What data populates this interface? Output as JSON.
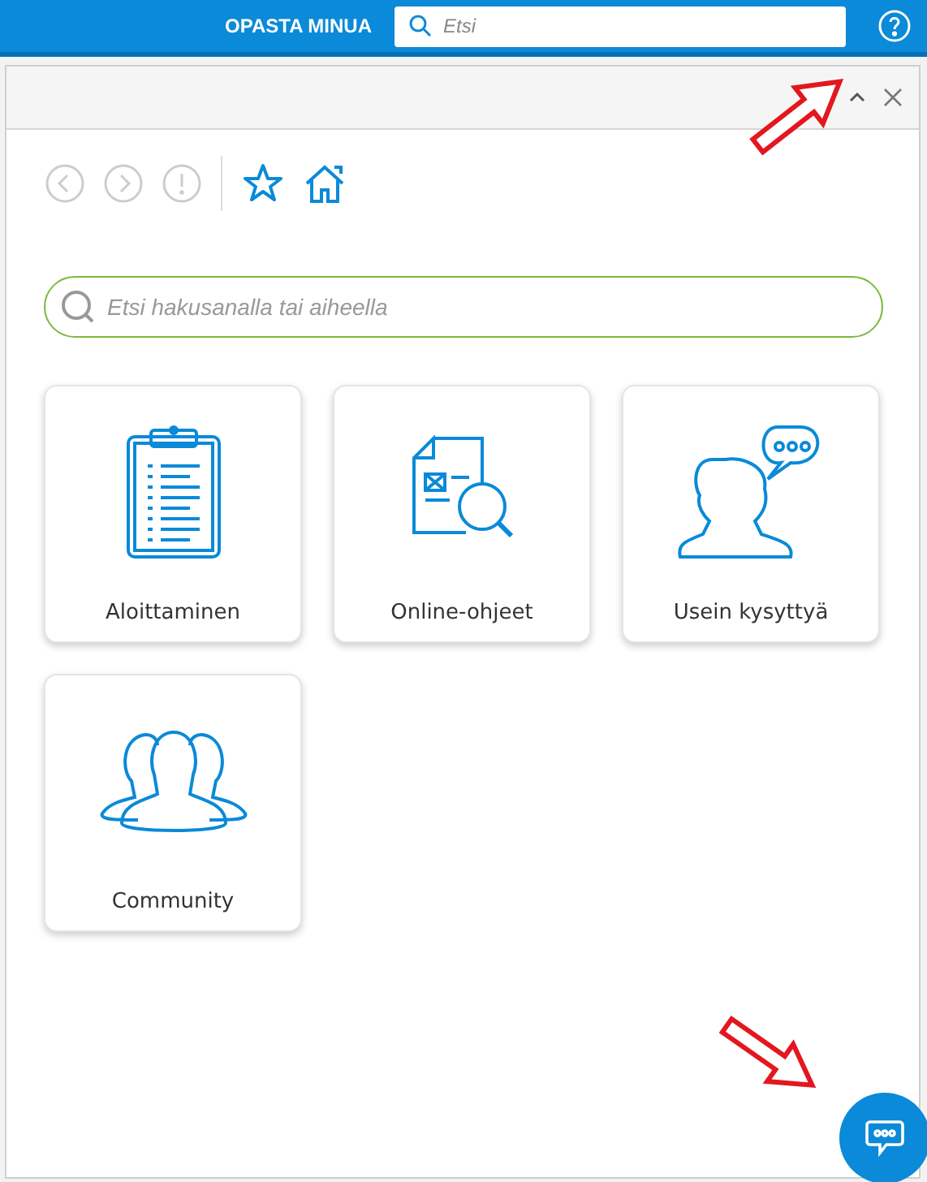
{
  "top_bar": {
    "title": "OPASTA MINUA",
    "search": {
      "placeholder": "Etsi"
    }
  },
  "panel": {
    "search": {
      "placeholder": "Etsi hakusanalla tai aiheella"
    },
    "cards": [
      {
        "kind": "clipboard",
        "label": "Aloittaminen"
      },
      {
        "kind": "document",
        "label": "Online-ohjeet"
      },
      {
        "kind": "faq",
        "label": "Usein kysyttyä"
      },
      {
        "kind": "community",
        "label": "Community"
      }
    ]
  }
}
